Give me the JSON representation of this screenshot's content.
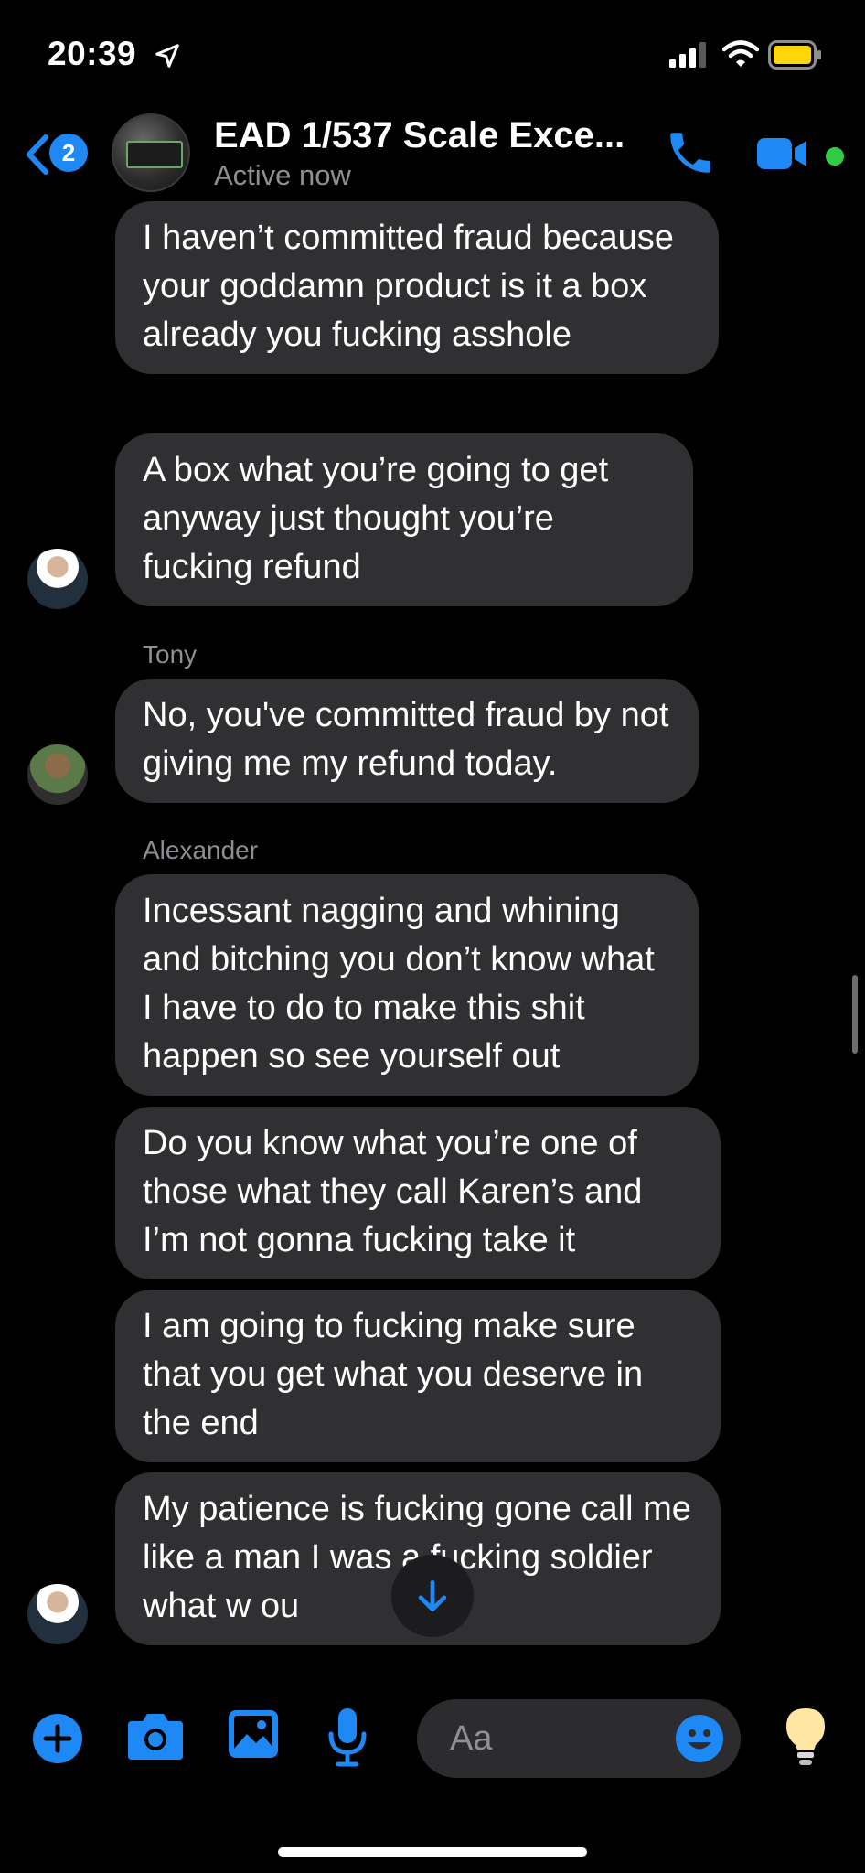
{
  "status_bar": {
    "time": "20:39"
  },
  "header": {
    "back_badge": "2",
    "title": "EAD 1/537  Scale Exce...",
    "status": "Active now"
  },
  "messages": [
    {
      "sender": "",
      "text": "I haven’t committed fraud because your goddamn product is it a box already you fucking asshole"
    },
    {
      "sender": "",
      "text": "A box what you’re going to get anyway just thought you’re fucking refund"
    },
    {
      "sender": "Tony",
      "text": "No, you've committed fraud by not giving me my refund today."
    },
    {
      "sender": "Alexander",
      "text": "Incessant nagging and whining and bitching you don’t know what I have to do to make this shit happen so see yourself out"
    },
    {
      "sender": "",
      "text": "Do you know what you’re one of those what they call Karen’s and I’m not gonna fucking take it"
    },
    {
      "sender": "",
      "text": "I am going to fucking make sure that you get what you deserve in the end"
    },
    {
      "sender": "",
      "text": "My patience is fucking gone call me like a man I was a fucking soldier what w      ou"
    }
  ],
  "composer": {
    "placeholder": "Aa"
  },
  "colors": {
    "accent": "#1e89f5",
    "bubble": "#303032",
    "online": "#31cc46",
    "battery": "#ffd60a"
  },
  "icons": [
    "location-arrow-icon",
    "signal-icon",
    "wifi-icon",
    "battery-icon",
    "back-chevron-icon",
    "phone-icon",
    "video-icon",
    "plus-icon",
    "camera-icon",
    "gallery-icon",
    "microphone-icon",
    "emoji-icon",
    "lightbulb-icon",
    "arrow-down-icon"
  ]
}
